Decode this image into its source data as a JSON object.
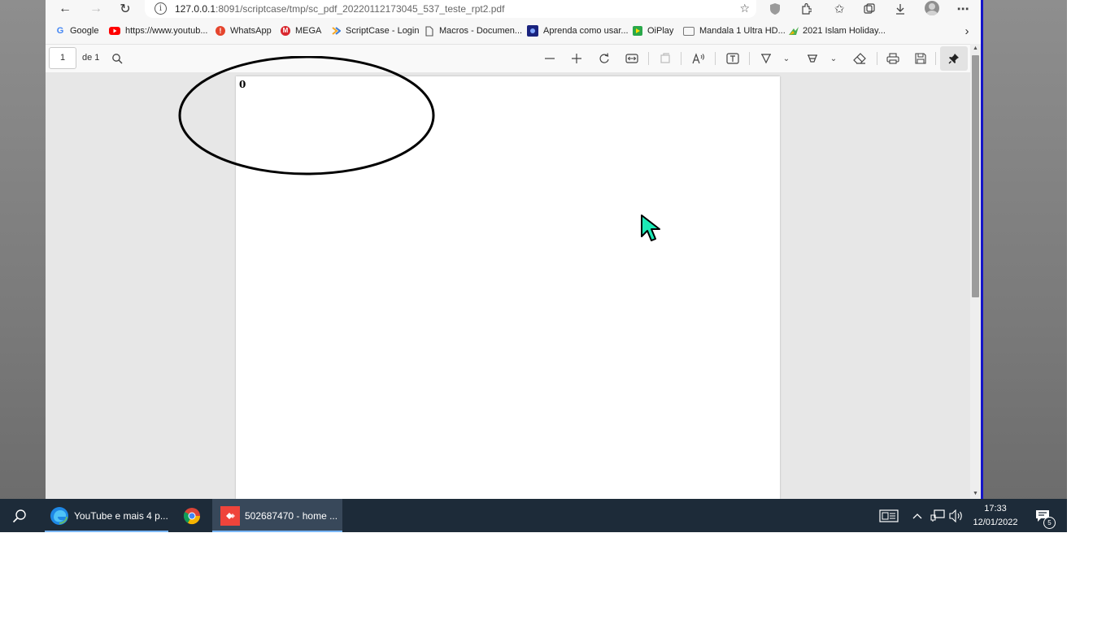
{
  "browser": {
    "url_host": "127.0.0.1",
    "url_path": ":8091/scriptcase/tmp/sc_pdf_20220112173045_537_teste_rpt2.pdf"
  },
  "bookmarks": [
    {
      "label": "Google",
      "icon": "google-icon",
      "color": "#4285f4"
    },
    {
      "label": "https://www.youtub...",
      "icon": "youtube-icon",
      "color": "#ff0000"
    },
    {
      "label": "WhatsApp",
      "icon": "whatsapp-icon",
      "color": "#e5452d"
    },
    {
      "label": "MEGA",
      "icon": "mega-icon",
      "color": "#d9272e"
    },
    {
      "label": "ScriptCase - Login",
      "icon": "scriptcase-icon",
      "color": "#3a7bd5"
    },
    {
      "label": "Macros - Documen...",
      "icon": "document-icon",
      "color": "#555555"
    },
    {
      "label": "Aprenda como usar...",
      "icon": "site-icon",
      "color": "#1a237e"
    },
    {
      "label": "OiPlay",
      "icon": "oiplay-icon",
      "color": "#2aa84a"
    },
    {
      "label": "Mandala 1 Ultra HD...",
      "icon": "mandala-icon",
      "color": "#666666"
    },
    {
      "label": "2021 Islam Holiday...",
      "icon": "islam-holiday-icon",
      "color": "#4caf50"
    }
  ],
  "pdf": {
    "current_page": "1",
    "page_total": "de 1",
    "content_value": "0"
  },
  "taskbar": {
    "apps": [
      {
        "label": "YouTube e mais 4 p...",
        "icon": "edge-icon"
      },
      {
        "label": "",
        "icon": "chrome-icon"
      },
      {
        "label": "502687470 - home ...",
        "icon": "anydesk-icon"
      }
    ],
    "time": "17:33",
    "date": "12/01/2022",
    "notification_count": "5"
  }
}
